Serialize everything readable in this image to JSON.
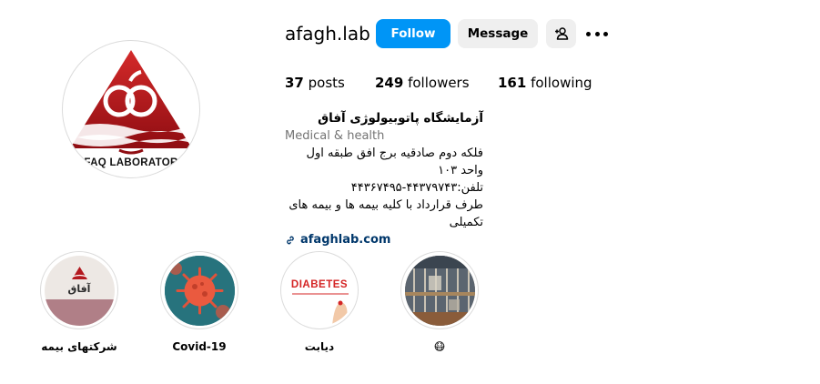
{
  "profile": {
    "username": "afagh.lab",
    "avatar_caption": "FAQ LABORATOR",
    "follow_label": "Follow",
    "message_label": "Message",
    "add_user_icon": "person-plus-icon",
    "more_icon": "more-horizontal-icon"
  },
  "stats": {
    "posts_count": "37",
    "posts_label": "posts",
    "followers_count": "249",
    "followers_label": "followers",
    "following_count": "161",
    "following_label": "following"
  },
  "bio": {
    "name": "آزمایشگاه پاتوبیولوژی آفاق",
    "category": "Medical & health",
    "line1": "فلکه دوم صادقیه برج افق طبقه اول واحد ۱۰۳",
    "line2": "تلفن:۴۴۳۷۹۷۴۳-۴۴۳۶۷۴۹۵",
    "line3": "طرف قرارداد با کلیه بیمه ها و بیمه های تکمیلی",
    "link_text": "afaghlab.com",
    "link_icon": "link-icon"
  },
  "highlights": [
    {
      "label": "شرکتهای بیمه",
      "cover_text": "آفاق"
    },
    {
      "label": "Covid-19"
    },
    {
      "label": "دیابت",
      "cover_text": "DIABETES"
    },
    {
      "label": "😷"
    }
  ],
  "colors": {
    "primary_button": "#0095f6",
    "secondary_button": "#efefef",
    "link": "#00376b",
    "category_text": "#737373",
    "logo_red": "#c0161d"
  }
}
